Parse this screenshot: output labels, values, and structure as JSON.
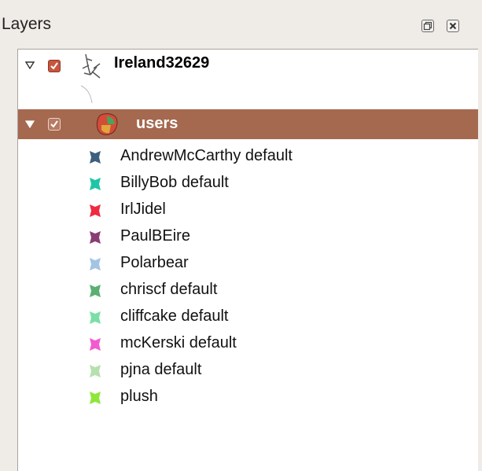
{
  "panel": {
    "title": "Layers"
  },
  "layers": [
    {
      "name": "Ireland32629",
      "checked": true,
      "expanded": true,
      "icon": "line-layer-icon"
    },
    {
      "name": "users",
      "checked": true,
      "expanded": true,
      "selected": true,
      "icon": "polygon-layer-icon"
    }
  ],
  "users_classes": [
    {
      "label": "AndrewMcCarthy default",
      "color": "#3d5f7f"
    },
    {
      "label": "BillyBob default",
      "color": "#1fc6a6"
    },
    {
      "label": "IrlJidel",
      "color": "#ee2a42"
    },
    {
      "label": "PaulBEire",
      "color": "#8a3d74"
    },
    {
      "label": "Polarbear",
      "color": "#a3c4e4"
    },
    {
      "label": "chriscf default",
      "color": "#5aaf71"
    },
    {
      "label": "cliffcake default",
      "color": "#78e0a4"
    },
    {
      "label": "mcKerski default",
      "color": "#f25bd0"
    },
    {
      "label": "pjna default",
      "color": "#b6e0ae"
    },
    {
      "label": "plush",
      "color": "#8ee63a"
    }
  ],
  "colors": {
    "selection": "#a5694f",
    "checkbox": "#c8553d"
  }
}
